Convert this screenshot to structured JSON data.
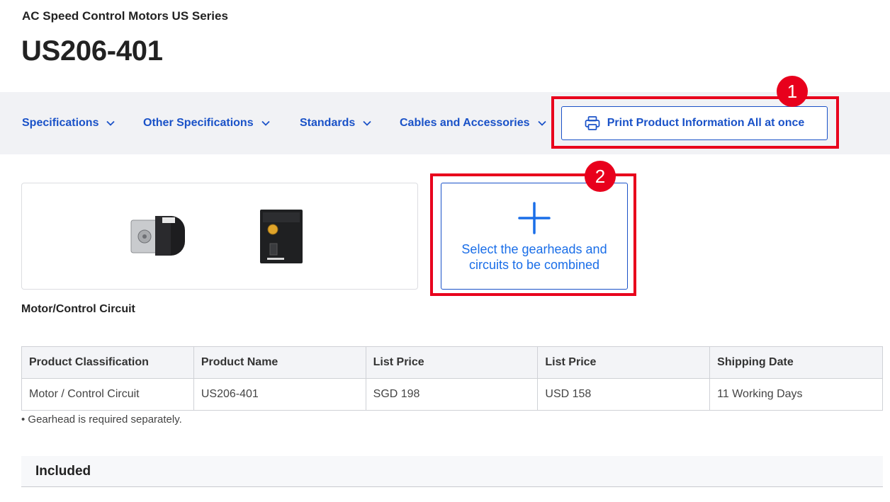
{
  "header": {
    "series": "AC Speed Control Motors US Series",
    "product": "US206-401"
  },
  "nav": {
    "items": [
      {
        "label": "Specifications"
      },
      {
        "label": "Other Specifications"
      },
      {
        "label": "Standards"
      },
      {
        "label": "Cables and Accessories"
      }
    ],
    "print_button": "Print Product Information All at once"
  },
  "annotations": [
    {
      "number": "1",
      "color": "#e8001c"
    },
    {
      "number": "2",
      "color": "#e8001c"
    }
  ],
  "product_images": {
    "caption": "Motor/Control Circuit",
    "images": [
      "motor-image",
      "control-circuit-image"
    ]
  },
  "combine": {
    "label": "Select the gearheads and circuits to be combined",
    "icon": "plus-icon"
  },
  "table": {
    "headers": [
      "Product Classification",
      "Product Name",
      "List Price",
      "List Price",
      "Shipping Date"
    ],
    "rows": [
      [
        "Motor / Control Circuit",
        "US206-401",
        "SGD 198",
        "USD 158",
        "11 Working Days"
      ]
    ]
  },
  "note": "• Gearhead is required separately.",
  "included": {
    "title": "Included"
  },
  "colors": {
    "link": "#1a52c8",
    "annotation": "#e8001c",
    "nav_background": "#f1f2f5"
  }
}
